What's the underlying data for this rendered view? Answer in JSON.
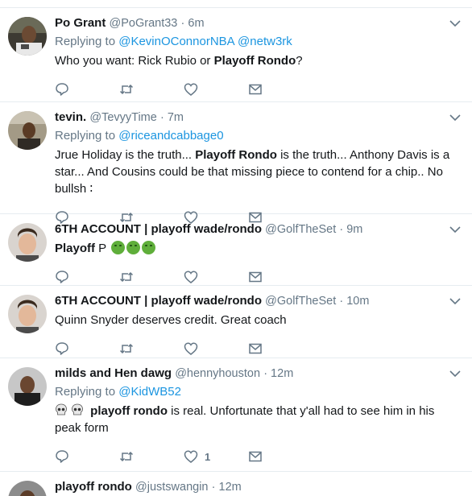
{
  "tweets": [
    {
      "name": "Po Grant",
      "handle": "@PoGrant33",
      "time": "· 6m",
      "replying_label": "Replying to",
      "replying_users": [
        "@KevinOConnorNBA",
        "@netw3rk"
      ],
      "text_1": "Who you want: Rick Rubio or ",
      "text_bold": "Playoff Rondo",
      "text_2": "?"
    },
    {
      "name": "tevin.",
      "handle": "@TevyyTime",
      "time": "· 7m",
      "replying_label": "Replying to",
      "replying_users": [
        "@riceandcabbage0"
      ],
      "text_1": "Jrue Holiday is the truth... ",
      "text_bold": "Playoff Rondo",
      "text_2": " is the truth... Anthony Davis is a star... And Cousins could be that missing piece to contend for a chip.. No bullsh ∶"
    },
    {
      "name": "6TH ACCOUNT | playoff wade/rondo",
      "handle": "@GolfTheSet",
      "time": "· 9m",
      "text_bold": "Playoff",
      "text_2": " P"
    },
    {
      "name": "6TH ACCOUNT | playoff wade/rondo",
      "handle": "@GolfTheSet",
      "time": "· 10m",
      "text_1": "Quinn Snyder deserves credit. Great coach"
    },
    {
      "name": "milds and Hen dawg",
      "handle": "@hennyhouston",
      "time": "· 12m",
      "replying_label": "Replying to",
      "replying_users": [
        "@KidWB52"
      ],
      "text_bold": "playoff rondo",
      "text_2": " is real. Unfortunate that y'all had to see him in his peak form",
      "like_count": "1"
    },
    {
      "name": "playoff rondo",
      "handle": "@justswangin",
      "time": "· 12m"
    }
  ],
  "icons": {
    "reply": "reply-icon",
    "retweet": "retweet-icon",
    "like": "heart-icon",
    "dm": "envelope-icon",
    "more": "chevron-down-icon"
  },
  "colors": {
    "link": "#1b95e0",
    "muted": "#657786",
    "icon": "#657786",
    "divider": "#e6ecf0"
  }
}
